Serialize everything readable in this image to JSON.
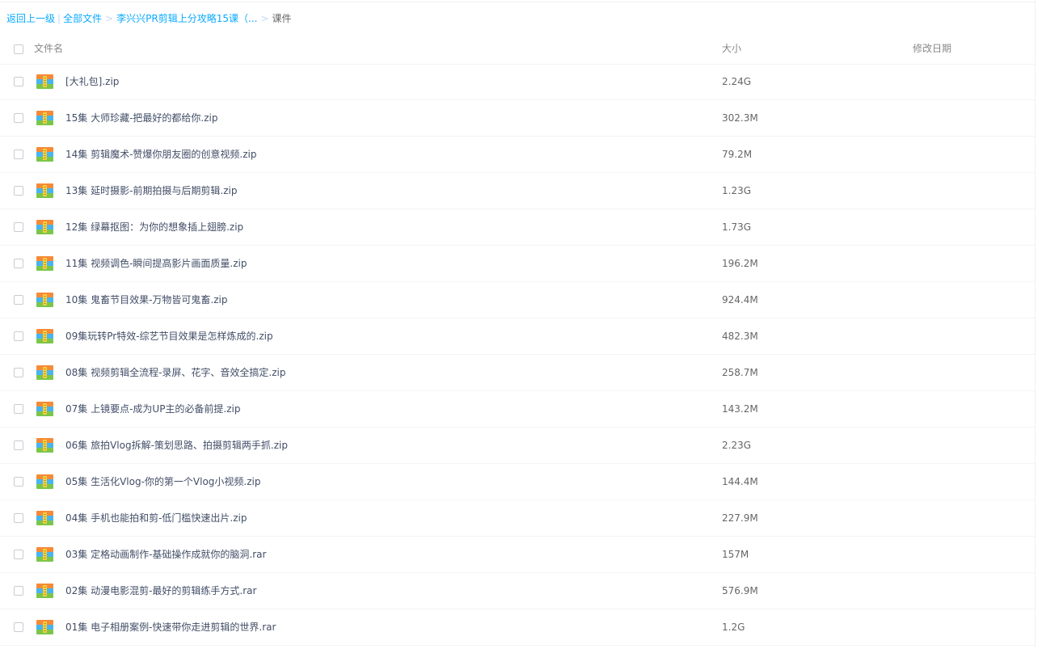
{
  "breadcrumb": {
    "back": "返回上一级",
    "all_files": "全部文件",
    "folder": "李兴兴PR剪辑上分攻略15课（...",
    "current": "课件",
    "separator": ">",
    "pipe": "|"
  },
  "table": {
    "headers": {
      "name": "文件名",
      "size": "大小",
      "modified": "修改日期"
    },
    "rows": [
      {
        "name": "[大礼包].zip",
        "size": "2.24G",
        "modified": "",
        "icon": "archive-icon"
      },
      {
        "name": "15集 大师珍藏-把最好的都给你.zip",
        "size": "302.3M",
        "modified": "",
        "icon": "archive-icon"
      },
      {
        "name": "14集 剪辑魔术-赞爆你朋友圈的创意视频.zip",
        "size": "79.2M",
        "modified": "",
        "icon": "archive-icon"
      },
      {
        "name": "13集 延时摄影-前期拍摄与后期剪辑.zip",
        "size": "1.23G",
        "modified": "",
        "icon": "archive-icon"
      },
      {
        "name": "12集 绿幕抠图：为你的想象插上翅膀.zip",
        "size": "1.73G",
        "modified": "",
        "icon": "archive-icon"
      },
      {
        "name": "11集 视频调色-瞬间提高影片画面质量.zip",
        "size": "196.2M",
        "modified": "",
        "icon": "archive-icon"
      },
      {
        "name": "10集 鬼畜节目效果-万物皆可鬼畜.zip",
        "size": "924.4M",
        "modified": "",
        "icon": "archive-icon"
      },
      {
        "name": "09集玩转Pr特效-综艺节目效果是怎样炼成的.zip",
        "size": "482.3M",
        "modified": "",
        "icon": "archive-icon"
      },
      {
        "name": "08集 视频剪辑全流程-录屏、花字、音效全搞定.zip",
        "size": "258.7M",
        "modified": "",
        "icon": "archive-icon"
      },
      {
        "name": "07集 上镜要点-成为UP主的必备前提.zip",
        "size": "143.2M",
        "modified": "",
        "icon": "archive-icon"
      },
      {
        "name": "06集 旅拍Vlog拆解-策划思路、拍摄剪辑两手抓.zip",
        "size": "2.23G",
        "modified": "",
        "icon": "archive-icon"
      },
      {
        "name": "05集 生活化Vlog-你的第一个Vlog小视频.zip",
        "size": "144.4M",
        "modified": "",
        "icon": "archive-icon"
      },
      {
        "name": "04集 手机也能拍和剪-低门槛快速出片.zip",
        "size": "227.9M",
        "modified": "",
        "icon": "archive-icon"
      },
      {
        "name": "03集 定格动画制作-基础操作成就你的脑洞.rar",
        "size": "157M",
        "modified": "",
        "icon": "archive-icon"
      },
      {
        "name": "02集 动漫电影混剪-最好的剪辑练手方式.rar",
        "size": "576.9M",
        "modified": "",
        "icon": "archive-icon"
      },
      {
        "name": "01集 电子相册案例-快速带你走进剪辑的世界.rar",
        "size": "1.2G",
        "modified": "",
        "icon": "archive-icon"
      }
    ]
  },
  "colors": {
    "link": "#09aaff",
    "text": "#424e67",
    "muted": "#888888",
    "icon_top": "#f58a38",
    "icon_mid": "#48b4f0",
    "icon_bottom": "#7bc64a",
    "icon_zip": "#f5d040"
  }
}
